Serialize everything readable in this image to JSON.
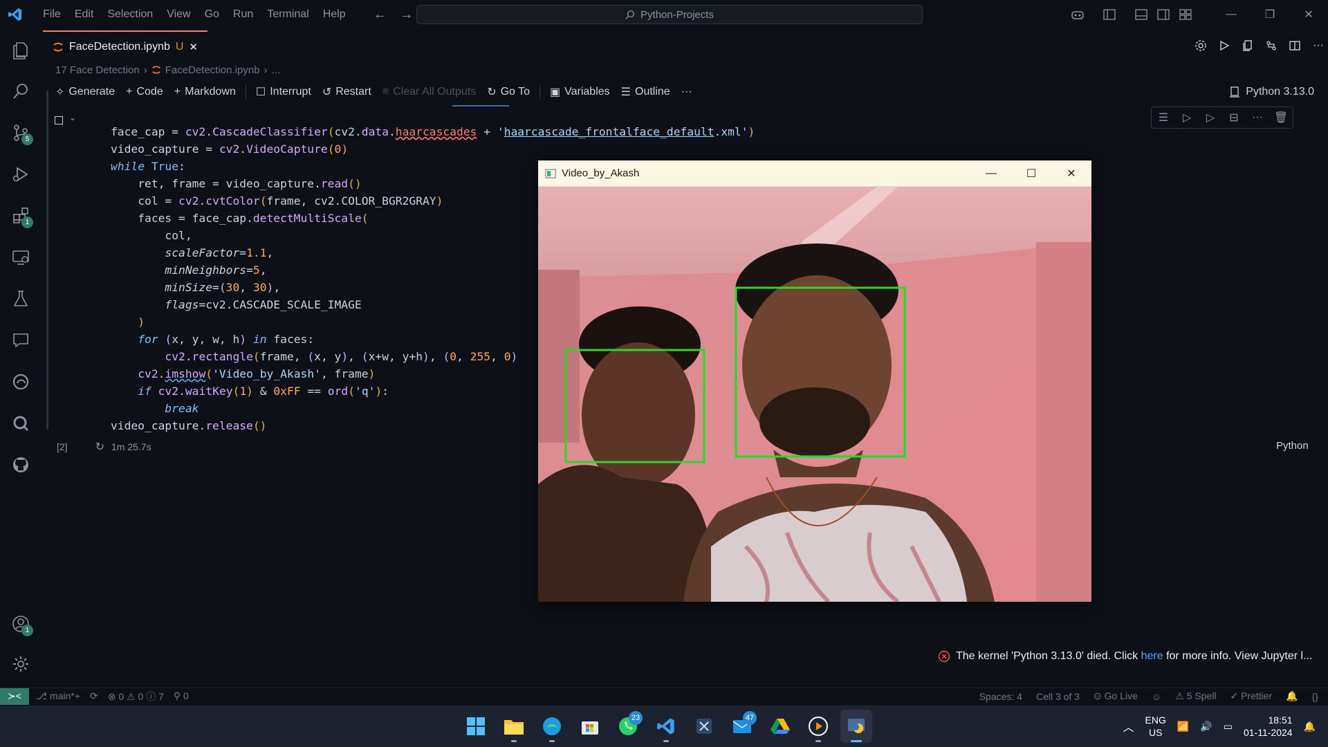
{
  "titlebar": {
    "menu": [
      "File",
      "Edit",
      "Selection",
      "View",
      "Go",
      "Run",
      "Terminal",
      "Help"
    ],
    "search": "Python-Projects"
  },
  "activity": {
    "scm_badge": "5",
    "ext_badge": "1",
    "account_badge": "1"
  },
  "tab": {
    "name": "FaceDetection.ipynb",
    "modified": "U"
  },
  "breadcrumb": {
    "folder": "17 Face Detection",
    "file": "FaceDetection.ipynb",
    "more": "..."
  },
  "notebook_toolbar": {
    "generate": "Generate",
    "code": "Code",
    "markdown": "Markdown",
    "interrupt": "Interrupt",
    "restart": "Restart",
    "clear": "Clear All Outputs",
    "goto": "Go To",
    "variables": "Variables",
    "outline": "Outline",
    "more": "···",
    "kernel": "Python 3.13.0"
  },
  "cell": {
    "exec_count": "[2]",
    "duration": "1m 25.7s",
    "language": "Python"
  },
  "video_window": {
    "title": "Video_by_Akash",
    "face_box_color": "#22dd22"
  },
  "notification": {
    "pre": "The kernel 'Python 3.13.0' died. Click ",
    "link": "here",
    "post": " for more info. View Jupyter l..."
  },
  "status": {
    "branch": "main*+",
    "errors": "0",
    "warnings": "0",
    "info": "7",
    "ports": "0",
    "spaces": "Spaces: 4",
    "cell": "Cell 3 of 3",
    "golive": "Go Live",
    "spell": "5 Spell",
    "prettier": "Prettier"
  },
  "taskbar": {
    "whatsapp_badge": "23",
    "mail_badge": "47",
    "lang1": "ENG",
    "lang2": "US",
    "time": "18:51",
    "date": "01-11-2024"
  },
  "colors": {
    "accent": "#2f7b67",
    "tab_border": "#f78166",
    "link": "#58a6ff"
  }
}
